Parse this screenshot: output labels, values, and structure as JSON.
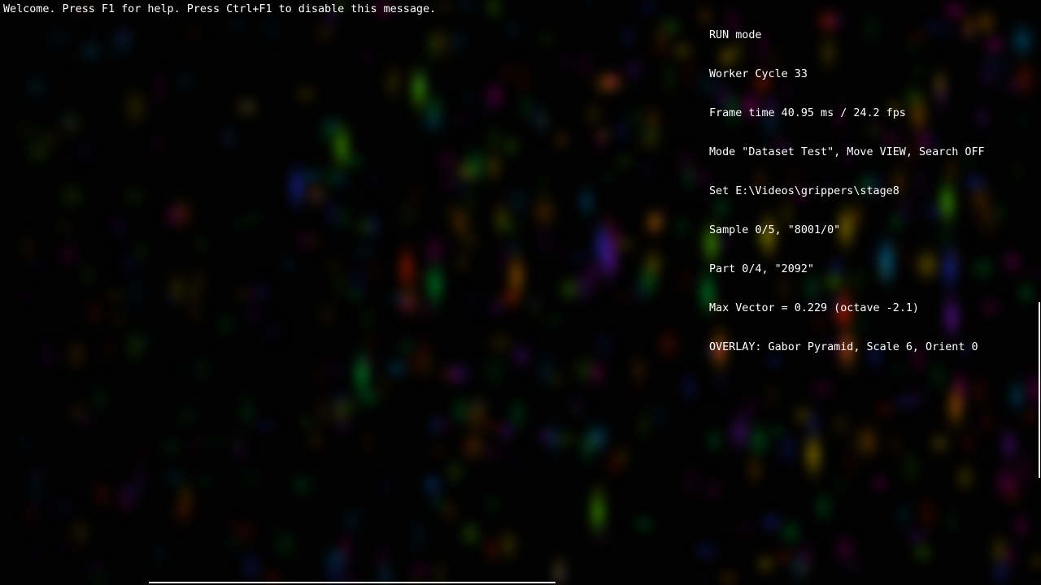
{
  "welcome_message": "Welcome. Press F1 for help. Press Ctrl+F1 to disable this message.",
  "status": {
    "mode": "RUN mode",
    "worker_cycle": "Worker Cycle 33",
    "frame_time": "Frame time 40.95 ms / 24.2 fps",
    "mode_line": "Mode \"Dataset Test\", Move VIEW, Search OFF",
    "set_path": "Set E:\\Videos\\grippers\\stage8",
    "sample": "Sample 0/5, \"8001/0\"",
    "part": "Part 0/4, \"2092\"",
    "max_vector": "Max Vector = 0.229 (octave -2.1)",
    "overlay": "OVERLAY: Gabor Pyramid, Scale 6, Orient 0"
  },
  "colors": {
    "background": "#000000",
    "text": "#ffffff",
    "overlay_palette": [
      "#ff2a00",
      "#ff8c00",
      "#ffd400",
      "#6cff00",
      "#00e040",
      "#00b0ff",
      "#2a3cff",
      "#a020ff",
      "#ff00c0"
    ]
  }
}
